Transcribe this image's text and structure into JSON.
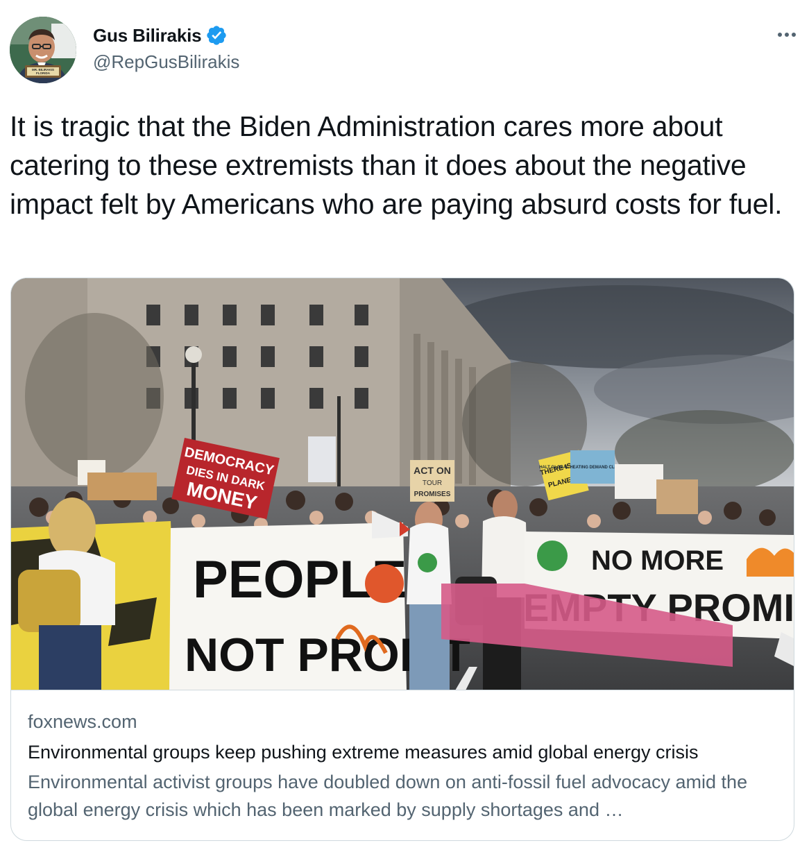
{
  "author": {
    "display_name": "Gus Bilirakis",
    "handle": "@RepGusBilirakis",
    "verified_color": "#1d9bf0",
    "avatar_nameplate": "MR. BILIRAKIS FLORIDA"
  },
  "tweet": {
    "text": "It is tragic that the Biden Administration cares more about catering to these extremists than it does about the negative impact felt by Americans who are paying absurd costs for fuel."
  },
  "link_card": {
    "domain": "foxnews.com",
    "title": "Environmental groups keep pushing extreme measures amid global energy crisis",
    "description": "Environmental activist groups have doubled down on anti-fossil fuel advocacy amid the global energy crisis which has been marked by supply shortages and …",
    "image_signs": {
      "democracy": "DEMOCRACY DIES IN DARK MONEY",
      "democracy_l1": "DEMOCRACY",
      "democracy_l2": "DIES IN DARK",
      "democracy_l3": "MONEY",
      "act_on": "ACT ON",
      "tour": "TOUR",
      "promises": "PROMISES",
      "there_is_no": "THERE IS NO",
      "planet_b": "PLANET B",
      "halt": "HALT GLOBAL HEATING DEMAND CLIMATE JUSTICE",
      "people": "PEOPLE",
      "not_profit": "NOT PROFIT",
      "no_more": "NO MORE",
      "empty_promise": "EMPTY PROMISE"
    }
  },
  "icons": {
    "more": "more-horizontal-icon",
    "verified": "verified-badge-icon"
  }
}
